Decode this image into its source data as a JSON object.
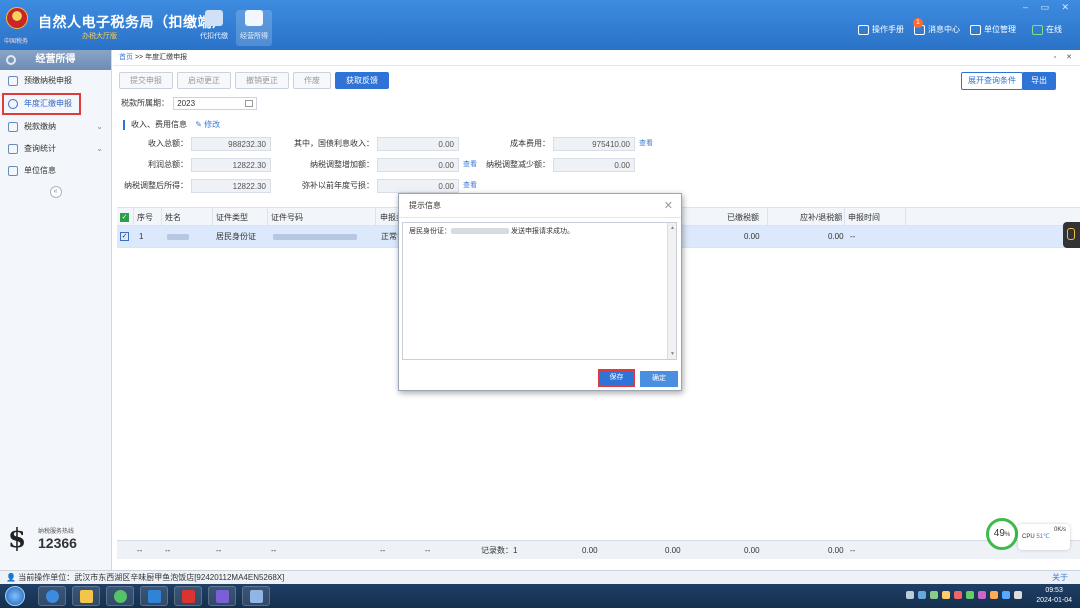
{
  "header": {
    "title": "自然人电子税务局（扣缴端）",
    "subtitle": "办税大厅版",
    "emblem_text": "中国税务",
    "modules": [
      "代扣代缴",
      "经营所得"
    ],
    "links": [
      "操作手册",
      "消息中心",
      "单位管理",
      "在线"
    ],
    "message_count": "1",
    "window_controls": "– ▭ ✕"
  },
  "sidebar": {
    "heading": "经营所得",
    "items": [
      {
        "label": "预缴纳税申报",
        "has_chevron": false,
        "active": false
      },
      {
        "label": "年度汇缴申报",
        "has_chevron": false,
        "active": true
      },
      {
        "label": "税款缴纳",
        "has_chevron": true,
        "active": false
      },
      {
        "label": "查询统计",
        "has_chevron": true,
        "active": false
      },
      {
        "label": "单位信息",
        "has_chevron": false,
        "active": false
      }
    ],
    "collapse": "«",
    "hotline_label": "纳税服务热线",
    "hotline_number": "12366"
  },
  "breadcrumb": {
    "home": "首页",
    "separator": ">>",
    "current": "年度汇缴申报",
    "controls": "▫ ✕"
  },
  "toolbar": {
    "buttons": [
      "提交申报",
      "启动更正",
      "撤销更正",
      "作废",
      "获取反馈"
    ],
    "expand_query": "展开查询条件",
    "export": "导出"
  },
  "period": {
    "label": "税款所属期：",
    "value": "2023"
  },
  "section": {
    "title": "收入、费用信息",
    "edit": "修改"
  },
  "fields": {
    "income_total": {
      "label": "收入总额：",
      "value": "988232.30"
    },
    "bond_interest": {
      "label": "其中，国债利息收入：",
      "value": "0.00"
    },
    "cost": {
      "label": "成本费用：",
      "value": "975410.00",
      "link": "查看"
    },
    "profit_total": {
      "label": "利润总额：",
      "value": "12822.30"
    },
    "adjust_increase": {
      "label": "纳税调整增加额：",
      "value": "0.00",
      "link": "查看"
    },
    "adjust_decrease": {
      "label": "纳税调整减少额：",
      "value": "0.00"
    },
    "adjusted_income": {
      "label": "纳税调整后所得：",
      "value": "12822.30"
    },
    "loss_offset": {
      "label": "弥补以前年度亏损：",
      "value": "0.00",
      "link": "查看"
    }
  },
  "grid": {
    "headers": [
      "序号",
      "姓名",
      "证件类型",
      "证件号码",
      "申报类",
      "已缴税额",
      "应补/退税额",
      "申报时间"
    ],
    "rows": [
      {
        "index": "1",
        "id_type": "居民身份证",
        "declare_type": "正常申",
        "paid": "0.00",
        "refund": "0.00",
        "time": "--"
      }
    ],
    "footer": {
      "dashes": "--",
      "record_count": "记录数：1",
      "v1": "0.00",
      "v2": "0.00",
      "v3": "0.00",
      "v4": "0.00",
      "end": "--"
    }
  },
  "dialog": {
    "title": "提示信息",
    "message_prefix": "居民身份证：",
    "message_suffix": "发送申报请求成功。",
    "save": "保存",
    "ok": "确定",
    "close": "✕"
  },
  "statusbar": {
    "unit": "当前操作单位：武汉市东西湖区辛味厨甲鱼泡饭店[92420112MA4EN5268X]",
    "about": "关于"
  },
  "widgets": {
    "gauge": "49",
    "gauge_unit": "%",
    "cpu_label": "CPU",
    "cpu_temp": "51℃",
    "net": "0K/s"
  },
  "taskbar": {
    "time": "09:53",
    "date": "2024-01-04"
  }
}
